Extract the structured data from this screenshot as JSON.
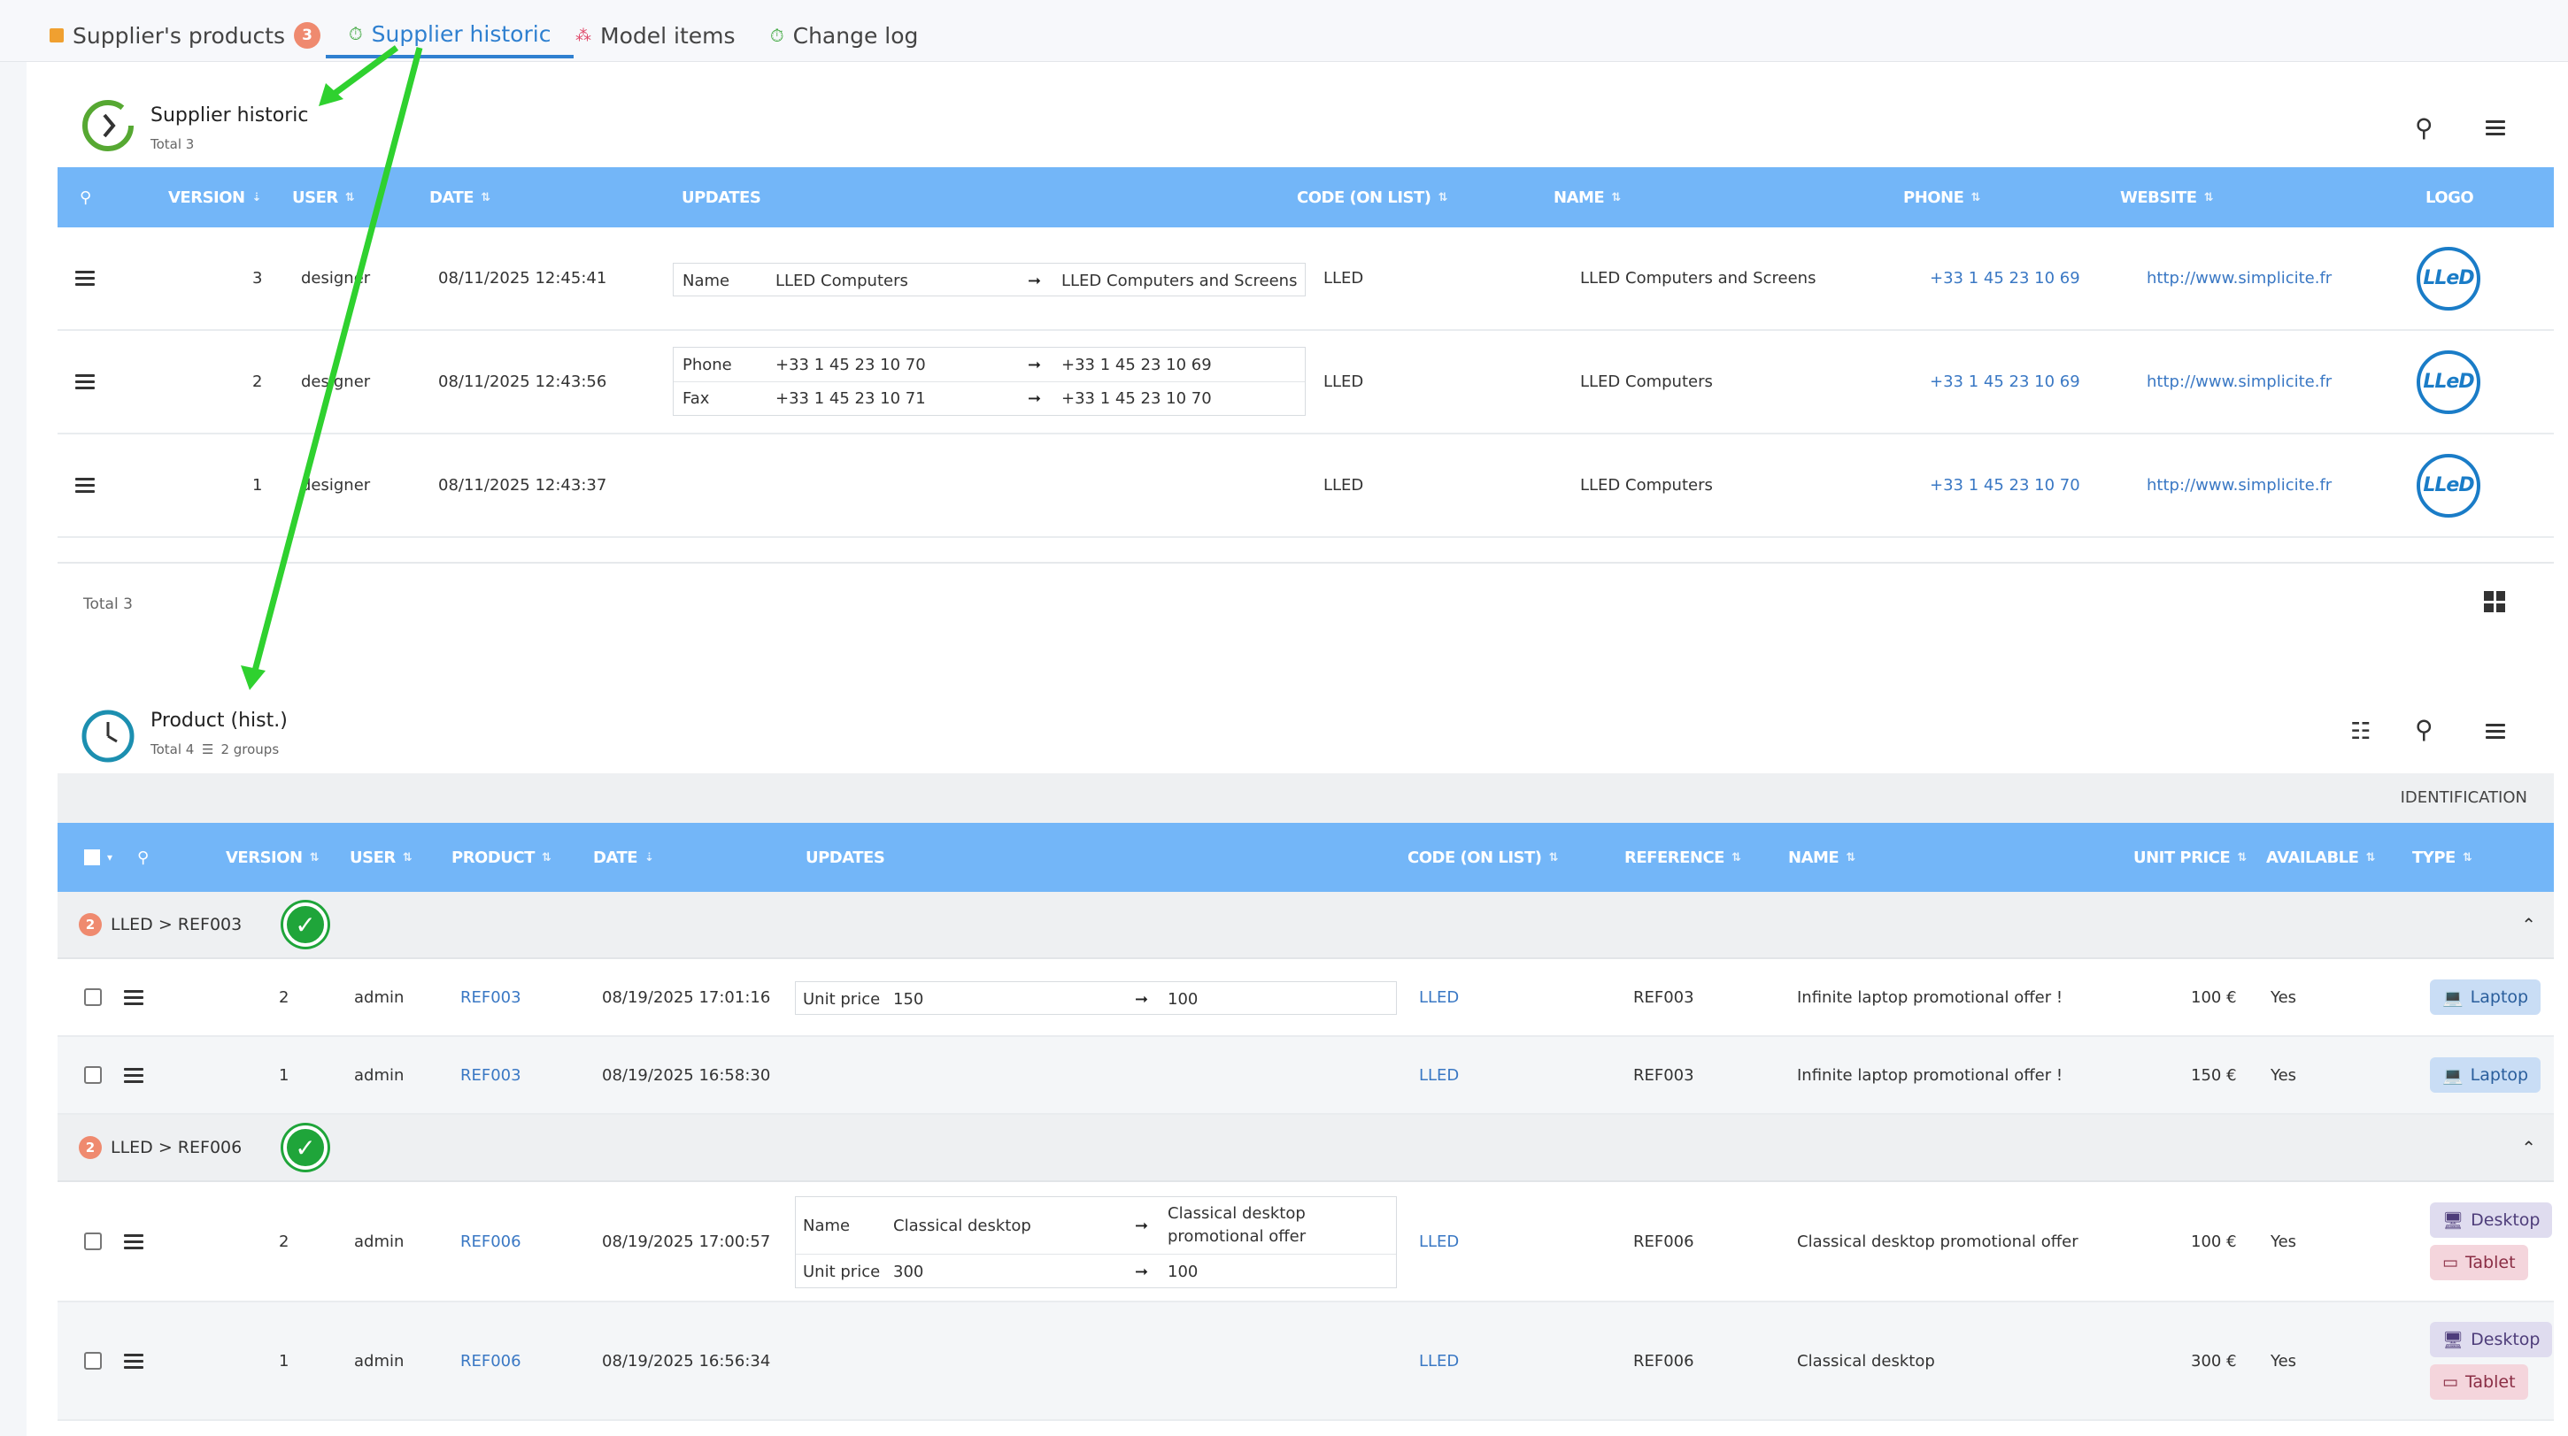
{
  "tabs": [
    {
      "label": "Supplier's products",
      "badge": "3"
    },
    {
      "label": "Supplier historic"
    },
    {
      "label": "Model items"
    },
    {
      "label": "Change log"
    }
  ],
  "supplier_historic": {
    "title": "Supplier historic",
    "total": "Total 3",
    "columns": {
      "version": "VERSION",
      "user": "USER",
      "date": "DATE",
      "updates": "UPDATES",
      "code": "CODE (ON LIST)",
      "name": "NAME",
      "phone": "PHONE",
      "website": "WEBSITE",
      "logo": "LOGO"
    },
    "rows": [
      {
        "version": "3",
        "user": "designer",
        "date": "08/11/2025 12:45:41",
        "updates": [
          {
            "field": "Name",
            "old": "LLED Computers",
            "new": "LLED Computers and Screens"
          }
        ],
        "code": "LLED",
        "name": "LLED Computers and Screens",
        "phone": "+33 1 45 23 10 69",
        "website": "http://www.simplicite.fr",
        "logo": "LLeD"
      },
      {
        "version": "2",
        "user": "designer",
        "date": "08/11/2025 12:43:56",
        "updates": [
          {
            "field": "Phone",
            "old": "+33 1 45 23 10 70",
            "new": "+33 1 45 23 10 69"
          },
          {
            "field": "Fax",
            "old": "+33 1 45 23 10 71",
            "new": "+33 1 45 23 10 70"
          }
        ],
        "code": "LLED",
        "name": "LLED Computers",
        "phone": "+33 1 45 23 10 69",
        "website": "http://www.simplicite.fr",
        "logo": "LLeD"
      },
      {
        "version": "1",
        "user": "designer",
        "date": "08/11/2025 12:43:37",
        "updates": [],
        "code": "LLED",
        "name": "LLED Computers",
        "phone": "+33 1 45 23 10 70",
        "website": "http://www.simplicite.fr",
        "logo": "LLeD"
      }
    ],
    "footer_total": "Total 3"
  },
  "product_hist": {
    "title": "Product (hist.)",
    "total": "Total 4",
    "groups_label": "2 groups",
    "identification": "IDENTIFICATION",
    "columns": {
      "version": "VERSION",
      "user": "USER",
      "product": "PRODUCT",
      "date": "DATE",
      "updates": "UPDATES",
      "code": "CODE (ON LIST)",
      "reference": "REFERENCE",
      "name": "NAME",
      "unit_price": "UNIT PRICE",
      "available": "AVAILABLE",
      "type": "TYPE"
    },
    "groups": [
      {
        "count": "2",
        "label": "LLED > REF003",
        "rows": [
          {
            "version": "2",
            "user": "admin",
            "product": "REF003",
            "date": "08/19/2025 17:01:16",
            "updates": [
              {
                "field": "Unit price",
                "old": "150",
                "new": "100"
              }
            ],
            "code": "LLED",
            "reference": "REF003",
            "name": "Infinite laptop promotional offer !",
            "unit_price": "100 €",
            "available": "Yes",
            "types": [
              "Laptop"
            ]
          },
          {
            "version": "1",
            "user": "admin",
            "product": "REF003",
            "date": "08/19/2025 16:58:30",
            "updates": [],
            "code": "LLED",
            "reference": "REF003",
            "name": "Infinite laptop promotional offer !",
            "unit_price": "150 €",
            "available": "Yes",
            "types": [
              "Laptop"
            ]
          }
        ]
      },
      {
        "count": "2",
        "label": "LLED > REF006",
        "rows": [
          {
            "version": "2",
            "user": "admin",
            "product": "REF006",
            "date": "08/19/2025 17:00:57",
            "updates": [
              {
                "field": "Name",
                "old": "Classical desktop",
                "new": "Classical desktop promotional offer"
              },
              {
                "field": "Unit price",
                "old": "300",
                "new": "100"
              }
            ],
            "code": "LLED",
            "reference": "REF006",
            "name": "Classical desktop promotional offer",
            "unit_price": "100 €",
            "available": "Yes",
            "types": [
              "Desktop",
              "Tablet"
            ]
          },
          {
            "version": "1",
            "user": "admin",
            "product": "REF006",
            "date": "08/19/2025 16:56:34",
            "updates": [],
            "code": "LLED",
            "reference": "REF006",
            "name": "Classical desktop",
            "unit_price": "300 €",
            "available": "Yes",
            "types": [
              "Desktop",
              "Tablet"
            ]
          }
        ]
      }
    ]
  },
  "colors": {
    "header_blue": "#73b6f8",
    "link_blue": "#3a78c4",
    "accent_green": "#1fa53a",
    "badge_orange": "#ef8a6f"
  }
}
